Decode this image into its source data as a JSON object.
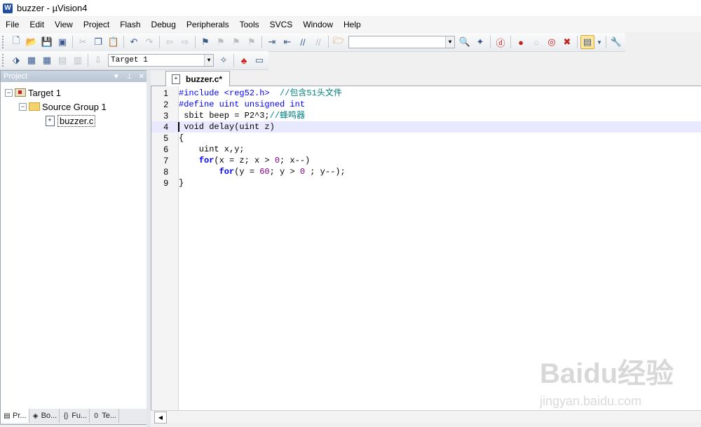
{
  "window": {
    "title": "buzzer  - µVision4",
    "app_icon": "W"
  },
  "menu": [
    {
      "label": "File"
    },
    {
      "label": "Edit"
    },
    {
      "label": "View"
    },
    {
      "label": "Project"
    },
    {
      "label": "Flash"
    },
    {
      "label": "Debug"
    },
    {
      "label": "Peripherals"
    },
    {
      "label": "Tools"
    },
    {
      "label": "SVCS"
    },
    {
      "label": "Window"
    },
    {
      "label": "Help"
    }
  ],
  "toolbar": {
    "target_select": "Target 1",
    "find_value": ""
  },
  "project_panel": {
    "title": "Project",
    "tree": {
      "target": "Target 1",
      "group": "Source Group 1",
      "file": "buzzer.c"
    },
    "tabs": [
      {
        "label": "Pr..."
      },
      {
        "label": "Bo..."
      },
      {
        "label": "Fu..."
      },
      {
        "label": "Te..."
      }
    ]
  },
  "editor": {
    "tab_label": "buzzer.c*",
    "lines": [
      {
        "n": "1",
        "parts": [
          {
            "t": "#include <reg52.h>  ",
            "c": "kw"
          },
          {
            "t": "//包含51头文件",
            "c": "cmt"
          }
        ]
      },
      {
        "n": "2",
        "parts": [
          {
            "t": "#define uint unsigned int",
            "c": "kw"
          }
        ]
      },
      {
        "n": "3",
        "parts": [
          {
            "t": " sbit beep = P2^3;",
            "c": ""
          },
          {
            "t": "//蜂鸣器",
            "c": "cmt"
          }
        ]
      },
      {
        "n": "4",
        "parts": [
          {
            "t": " void delay(uint z)",
            "c": ""
          }
        ],
        "current": true
      },
      {
        "n": "5",
        "parts": [
          {
            "t": "{",
            "c": ""
          }
        ]
      },
      {
        "n": "6",
        "parts": [
          {
            "t": "    uint x,y;",
            "c": ""
          }
        ]
      },
      {
        "n": "7",
        "parts": [
          {
            "t": "    ",
            "c": ""
          },
          {
            "t": "for",
            "c": "kwb"
          },
          {
            "t": "(x = z; x > ",
            "c": ""
          },
          {
            "t": "0",
            "c": "num"
          },
          {
            "t": "; x--)",
            "c": ""
          }
        ]
      },
      {
        "n": "8",
        "parts": [
          {
            "t": "        ",
            "c": ""
          },
          {
            "t": "for",
            "c": "kwb"
          },
          {
            "t": "(y = ",
            "c": ""
          },
          {
            "t": "60",
            "c": "num"
          },
          {
            "t": "; y > ",
            "c": ""
          },
          {
            "t": "0",
            "c": "num"
          },
          {
            "t": " ; y--);",
            "c": ""
          }
        ]
      },
      {
        "n": "9",
        "parts": [
          {
            "t": "}",
            "c": ""
          }
        ]
      }
    ]
  },
  "watermark": {
    "brand": "Baidu经验",
    "url": "jingyan.baidu.com"
  }
}
